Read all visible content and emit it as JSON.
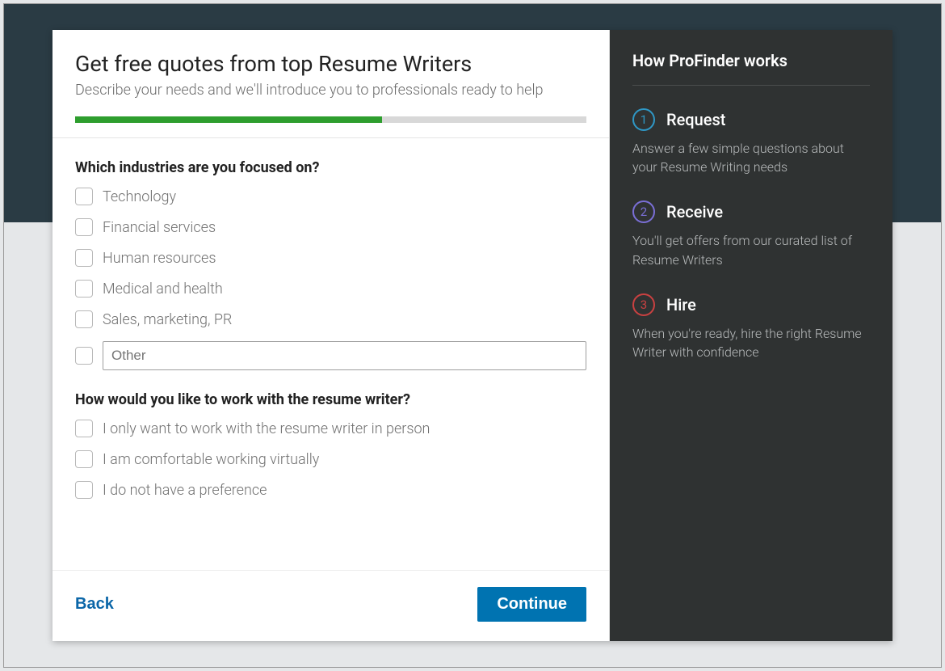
{
  "header": {
    "title": "Get free quotes from top Resume Writers",
    "subtitle": "Describe your needs and we'll introduce you to professionals ready to help",
    "progress_percent": 60
  },
  "questions": {
    "q1": {
      "title": "Which industries are you focused on?",
      "options": [
        {
          "label": "Technology"
        },
        {
          "label": "Financial services"
        },
        {
          "label": "Human resources"
        },
        {
          "label": "Medical and health"
        },
        {
          "label": "Sales, marketing, PR"
        }
      ],
      "other_placeholder": "Other"
    },
    "q2": {
      "title": "How would you like to work with the resume writer?",
      "options": [
        {
          "label": "I only want to work with the resume writer in person"
        },
        {
          "label": "I am comfortable working virtually"
        },
        {
          "label": "I do not have a preference"
        }
      ]
    }
  },
  "footer": {
    "back_label": "Back",
    "continue_label": "Continue"
  },
  "right": {
    "title": "How ProFinder works",
    "steps": [
      {
        "num": "1",
        "title": "Request",
        "desc": "Answer a few simple questions about your Resume Writing needs"
      },
      {
        "num": "2",
        "title": "Receive",
        "desc": "You'll get offers from our curated list of Resume Writers"
      },
      {
        "num": "3",
        "title": "Hire",
        "desc": "When you're ready, hire the right Resume Writer with confidence"
      }
    ]
  }
}
